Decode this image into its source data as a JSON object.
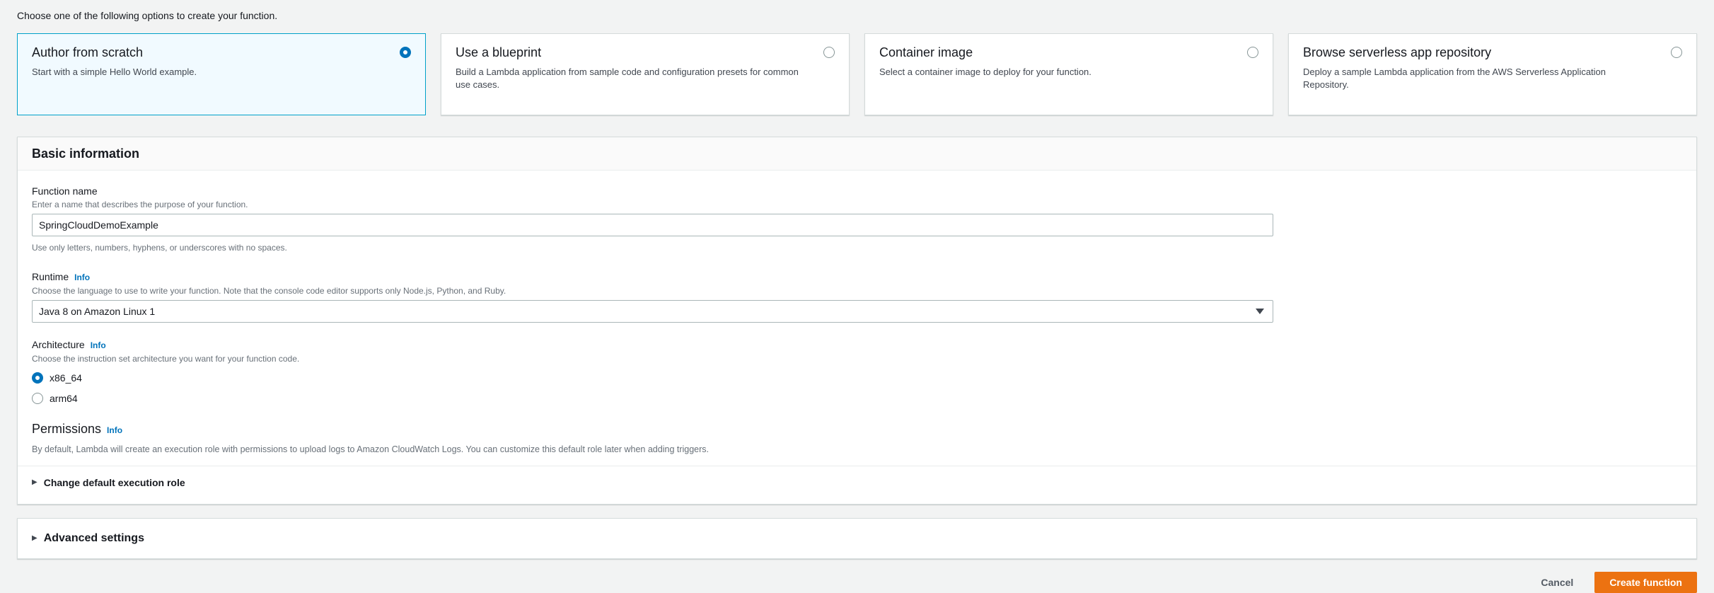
{
  "page": {
    "intro": "Choose one of the following options to create your function."
  },
  "options": [
    {
      "title": "Author from scratch",
      "description": "Start with a simple Hello World example.",
      "selected": true
    },
    {
      "title": "Use a blueprint",
      "description": "Build a Lambda application from sample code and configuration presets for common use cases.",
      "selected": false
    },
    {
      "title": "Container image",
      "description": "Select a container image to deploy for your function.",
      "selected": false
    },
    {
      "title": "Browse serverless app repository",
      "description": "Deploy a sample Lambda application from the AWS Serverless Application Repository.",
      "selected": false
    }
  ],
  "basic_information": {
    "title": "Basic information",
    "function_name": {
      "label": "Function name",
      "description": "Enter a name that describes the purpose of your function.",
      "value": "SpringCloudDemoExample",
      "constraint": "Use only letters, numbers, hyphens, or underscores with no spaces."
    },
    "runtime": {
      "label": "Runtime",
      "info_label": "Info",
      "description": "Choose the language to use to write your function. Note that the console code editor supports only Node.js, Python, and Ruby.",
      "selected_option": "Java 8 on Amazon Linux 1"
    },
    "architecture": {
      "label": "Architecture",
      "info_label": "Info",
      "description": "Choose the instruction set architecture you want for your function code.",
      "options": [
        {
          "label": "x86_64",
          "selected": true
        },
        {
          "label": "arm64",
          "selected": false
        }
      ]
    },
    "permissions": {
      "label": "Permissions",
      "info_label": "Info",
      "description": "By default, Lambda will create an execution role with permissions to upload logs to Amazon CloudWatch Logs. You can customize this default role later when adding triggers."
    },
    "change_role_expander": "Change default execution role"
  },
  "advanced_settings": {
    "label": "Advanced settings"
  },
  "footer": {
    "cancel_label": "Cancel",
    "create_label": "Create function"
  },
  "icons": {
    "caret_right": "▶",
    "caret_down": "▼"
  },
  "colors": {
    "accent_orange": "#ec7211",
    "link_blue": "#0073bb",
    "selected_card_border": "#00a1c9",
    "selected_card_bg": "#f1faff",
    "radio_checked": "#0073bb",
    "page_bg": "#f2f3f3"
  }
}
